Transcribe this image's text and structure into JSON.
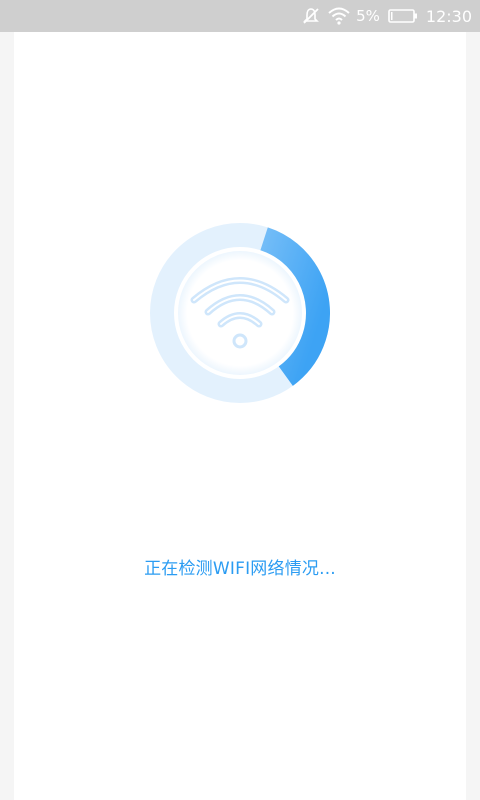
{
  "status_bar": {
    "battery_percent": "5%",
    "time": "12:30",
    "icons": [
      "mute-icon",
      "wifi-signal-icon",
      "battery-icon"
    ]
  },
  "detection": {
    "progress": 0.35,
    "message": "正在检测WIFI网络情况...",
    "icon": "wifi-icon",
    "colors": {
      "accent": "#2b9cf2",
      "ring_track": "#e3f1fd",
      "ring_progress_start": "#a9d6fb",
      "ring_progress_end": "#3da3f4",
      "wifi_arcs": "#cfe6fb"
    }
  }
}
